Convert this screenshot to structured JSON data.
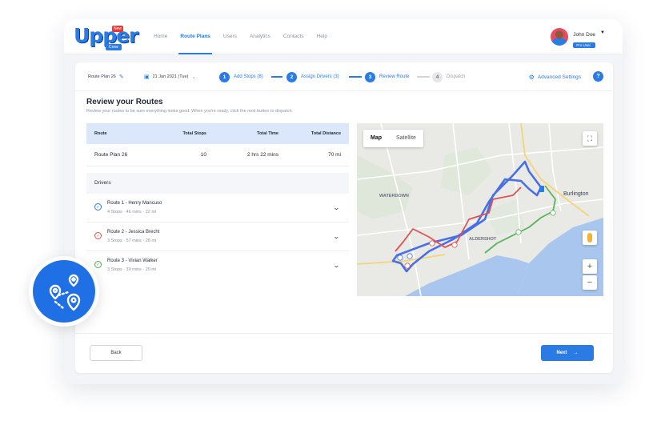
{
  "brand": {
    "logo_text": "Upper",
    "logo_new": "New",
    "logo_crew": "Crew"
  },
  "nav": {
    "items": [
      {
        "label": "Home",
        "active": false
      },
      {
        "label": "Route Plans",
        "active": true
      },
      {
        "label": "Users",
        "active": false
      },
      {
        "label": "Analytics",
        "active": false
      },
      {
        "label": "Contacts",
        "active": false
      },
      {
        "label": "Help",
        "active": false
      }
    ]
  },
  "user": {
    "name": "John Doe",
    "badge": "Pro User"
  },
  "stepbar": {
    "plan_name": "Route Plan 26",
    "date": "21 Jan 2021 (Tue)",
    "steps": [
      {
        "num": "1",
        "label": "Add Stops (8)",
        "active": true
      },
      {
        "num": "2",
        "label": "Assign Drivers (3)",
        "active": true
      },
      {
        "num": "3",
        "label": "Review Route",
        "active": true
      },
      {
        "num": "4",
        "label": "Dispatch",
        "active": false
      }
    ],
    "advanced": "Advanced Settings",
    "help": "?"
  },
  "page": {
    "title": "Review your Routes",
    "subtitle": "Review your routes to be sure everything looks good. When you're ready, click the next button to dispatch."
  },
  "summary": {
    "headers": {
      "route": "Route",
      "stops": "Total Stops",
      "time": "Total Time",
      "distance": "Total Distance"
    },
    "row": {
      "route": "Route Plan 26",
      "stops": "10",
      "time": "2 hrs 22 mins",
      "distance": "70 mi"
    }
  },
  "drivers": {
    "header": "Drivers",
    "items": [
      {
        "name": "Route 1 - Henry Mancuso",
        "stops": "4 Stops",
        "time": "46 mins",
        "distance": "22 mi",
        "color": "#2b7be4"
      },
      {
        "name": "Route 2 - Jessica Brecht",
        "stops": "3 Stops",
        "time": "57 mins",
        "distance": "28 mi",
        "color": "#e05252"
      },
      {
        "name": "Route 3 - Vivian Walker",
        "stops": "3 Stops",
        "time": "39 mins",
        "distance": "20 mi",
        "color": "#4caf50"
      }
    ]
  },
  "map": {
    "tabs": [
      {
        "label": "Map",
        "active": true
      },
      {
        "label": "Satellite",
        "active": false
      }
    ],
    "labels": {
      "waterdown": "WATERDOWN",
      "burlington": "Burlington",
      "aldershot": "ALDERSHOT"
    },
    "zoom_in": "+",
    "zoom_out": "−"
  },
  "footer": {
    "back": "Back",
    "next": "Next"
  },
  "colors": {
    "accent": "#2b7be4",
    "route1": "#4a6fe3",
    "route2": "#e05252",
    "route3": "#58b35a"
  }
}
